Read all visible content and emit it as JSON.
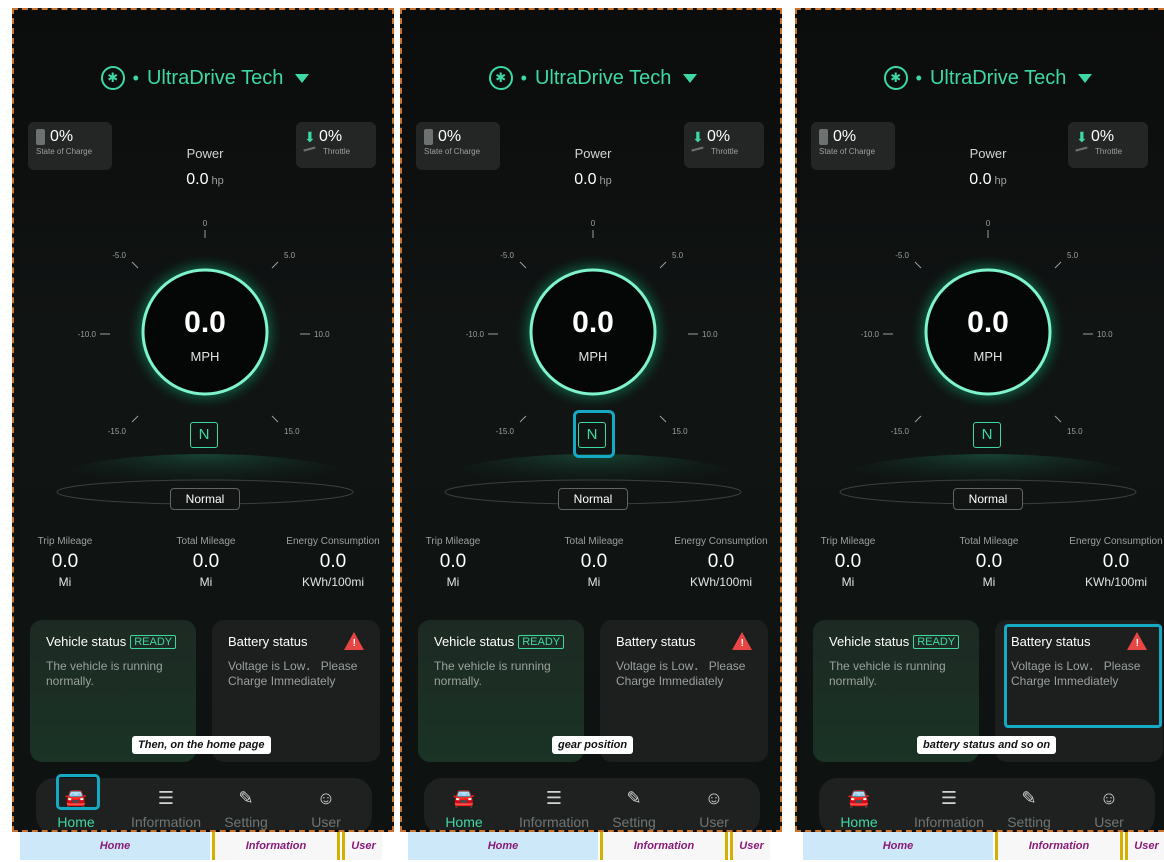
{
  "brand": "UltraDrive Tech",
  "state_of_charge": {
    "value": "0%",
    "label": "State of Charge"
  },
  "throttle": {
    "value": "0%",
    "label": "Throttle"
  },
  "power": {
    "label": "Power",
    "value": "0.0",
    "unit": "hp"
  },
  "gauge_ticks": {
    "top": "0",
    "upper_left": "-5.0",
    "upper_right": "5.0",
    "left": "-10.0",
    "right": "10.0",
    "lower_left": "-15.0",
    "lower_right": "15.0"
  },
  "speed": {
    "value": "0.0",
    "unit": "MPH"
  },
  "gear": "N",
  "mode": "Normal",
  "stats": [
    {
      "label": "Trip Mileage",
      "value": "0.0",
      "unit": "Mi"
    },
    {
      "label": "Total Mileage",
      "value": "0.0",
      "unit": "Mi"
    },
    {
      "label": "Energy Consumption",
      "value": "0.0",
      "unit": "KWh/100mi"
    }
  ],
  "vehicle_status": {
    "title": "Vehicle status",
    "badge": "READY",
    "body": "The vehicle is running normally."
  },
  "battery_status": {
    "title": "Battery status",
    "body": "Voltage is Low． Please Charge Immediately"
  },
  "tabs": {
    "home": "Home",
    "information": "Information",
    "setting": "Setting",
    "user": "User"
  },
  "captions": [
    "Then, on the home page",
    "gear position",
    "battery status and so on"
  ],
  "bottom_strip": {
    "home": "Home",
    "information": "Information",
    "user": "User"
  },
  "colors": {
    "accent": "#3ed9a2",
    "highlight": "#16a9c4",
    "warning": "#e84545"
  }
}
